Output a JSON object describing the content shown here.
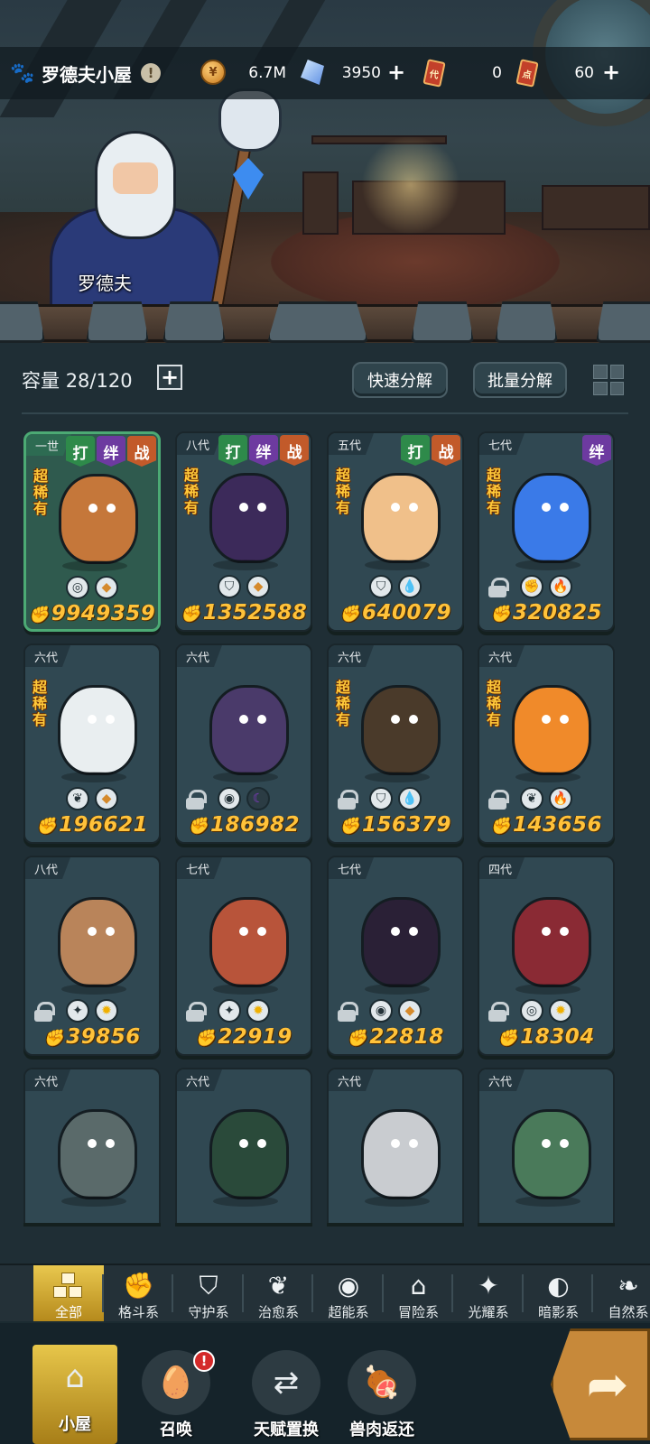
{
  "header": {
    "title": "罗德夫小屋",
    "info": "!",
    "resources": [
      {
        "name": "gold",
        "icon": "gold-coin-icon",
        "value": "6.7M"
      },
      {
        "name": "crystal",
        "icon": "crystal-icon",
        "value": "3950"
      },
      {
        "name": "ticket-dai",
        "icon": "ticket-icon",
        "label": "代",
        "value": "0"
      },
      {
        "name": "ticket-dian",
        "icon": "ticket-icon",
        "label": "点",
        "value": "60"
      }
    ],
    "plus": "+"
  },
  "scene": {
    "npc_name": "罗德夫"
  },
  "toolbar": {
    "capacity_label": "容量",
    "capacity_value": "28/120",
    "plus": "+",
    "quick_decompose": "快速分解",
    "batch_decompose": "批量分解"
  },
  "rare_text": "超稀有",
  "tags": {
    "hit": "打",
    "bond": "绊",
    "war": "战"
  },
  "cards": [
    {
      "gen": "一世",
      "power": "9949359",
      "rare": true,
      "tags": [
        "hit",
        "bond",
        "war"
      ],
      "locked": false,
      "elements": [
        "guard-icon",
        "beast-icon"
      ],
      "color": "#c5773a"
    },
    {
      "gen": "八代",
      "power": "1352588",
      "rare": true,
      "tags": [
        "hit",
        "bond",
        "war"
      ],
      "locked": false,
      "elements": [
        "shield-icon",
        "beast-icon"
      ],
      "color": "#3c2a5a"
    },
    {
      "gen": "五代",
      "power": "640079",
      "rare": true,
      "tags": [
        "hit",
        "war"
      ],
      "locked": false,
      "elements": [
        "shield-icon",
        "water-icon"
      ],
      "color": "#f0c08a"
    },
    {
      "gen": "七代",
      "power": "320825",
      "rare": true,
      "tags": [
        "bond"
      ],
      "locked": true,
      "elements": [
        "fist-icon",
        "fire-icon"
      ],
      "color": "#3a7ae8"
    },
    {
      "gen": "六代",
      "power": "196621",
      "rare": true,
      "tags": [],
      "locked": false,
      "elements": [
        "leaf-icon",
        "beast-icon"
      ],
      "color": "#e9eef0"
    },
    {
      "gen": "六代",
      "power": "186982",
      "rare": false,
      "tags": [],
      "locked": true,
      "elements": [
        "eye-icon",
        "moon-icon"
      ],
      "color": "#4a3a6a"
    },
    {
      "gen": "六代",
      "power": "156379",
      "rare": true,
      "tags": [],
      "locked": true,
      "elements": [
        "shield-icon",
        "water-icon"
      ],
      "color": "#4a3a2a"
    },
    {
      "gen": "六代",
      "power": "143656",
      "rare": true,
      "tags": [],
      "locked": true,
      "elements": [
        "leaf-icon",
        "fire-icon"
      ],
      "color": "#f08a2a"
    },
    {
      "gen": "八代",
      "power": "39856",
      "rare": false,
      "tags": [],
      "locked": true,
      "elements": [
        "star-cross-icon",
        "sun-icon"
      ],
      "color": "#b9845a"
    },
    {
      "gen": "七代",
      "power": "22919",
      "rare": false,
      "tags": [],
      "locked": true,
      "elements": [
        "star-cross-icon",
        "sun-icon"
      ],
      "color": "#b8543a"
    },
    {
      "gen": "七代",
      "power": "22818",
      "rare": false,
      "tags": [],
      "locked": true,
      "elements": [
        "eye-icon",
        "beast-icon"
      ],
      "color": "#2a2036"
    },
    {
      "gen": "四代",
      "power": "18304",
      "rare": false,
      "tags": [],
      "locked": true,
      "elements": [
        "guard-icon",
        "sun-icon"
      ],
      "color": "#8a2a34"
    },
    {
      "gen": "六代",
      "power": "",
      "rare": false,
      "tags": [],
      "locked": true,
      "elements": [],
      "color": "#5a6a6a"
    },
    {
      "gen": "六代",
      "power": "",
      "rare": false,
      "tags": [],
      "locked": true,
      "elements": [],
      "color": "#2a4a3a"
    },
    {
      "gen": "六代",
      "power": "",
      "rare": false,
      "tags": [],
      "locked": true,
      "elements": [],
      "color": "#c9ccd0"
    },
    {
      "gen": "六代",
      "power": "",
      "rare": false,
      "tags": [],
      "locked": true,
      "elements": [],
      "color": "#4a7a5a"
    }
  ],
  "categories": [
    {
      "label": "全部",
      "icon": "all-blocks-icon"
    },
    {
      "label": "格斗系",
      "icon": "fist-icon"
    },
    {
      "label": "守护系",
      "icon": "shield-icon"
    },
    {
      "label": "治愈系",
      "icon": "leaf-icon"
    },
    {
      "label": "超能系",
      "icon": "alien-icon"
    },
    {
      "label": "冒险系",
      "icon": "adventure-icon"
    },
    {
      "label": "光耀系",
      "icon": "star-cross-icon"
    },
    {
      "label": "暗影系",
      "icon": "eye-icon"
    },
    {
      "label": "自然系",
      "icon": "nature-icon"
    }
  ],
  "nav": [
    {
      "label": "小屋",
      "icon": "house-icon"
    },
    {
      "label": "召唤",
      "icon": "egg-icon",
      "badge": "!"
    },
    {
      "label": "天赋置换",
      "icon": "swap-icon"
    },
    {
      "label": "兽肉返还",
      "icon": "meat-icon"
    }
  ]
}
